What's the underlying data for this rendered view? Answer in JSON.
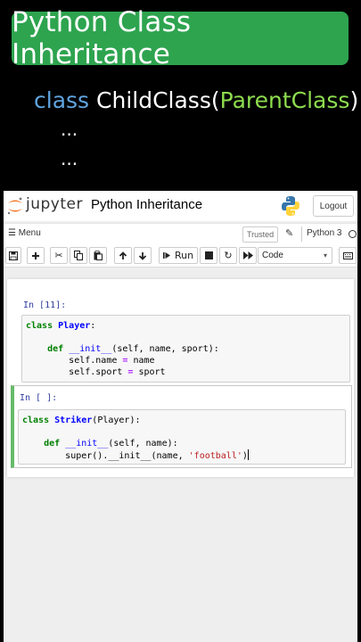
{
  "banner": {
    "title": "Python Class Inheritance"
  },
  "syntax": {
    "class_kw": "class",
    "child": "ChildClass",
    "open_paren": "(",
    "parent": "ParentClass",
    "close": "):",
    "ellipsis_1": "...",
    "ellipsis_2": "..."
  },
  "jupyter": {
    "logo_text": "jupyter",
    "notebook_name": "Python Inheritance",
    "logout_label": "Logout",
    "menu_label": "Menu",
    "trusted_label": "Trusted",
    "kernel_name": "Python 3",
    "run_label": "Run",
    "cell_type": "Code",
    "icons": [
      "save-icon",
      "add-cell-icon",
      "cut-icon",
      "copy-icon",
      "paste-icon",
      "move-up-icon",
      "move-down-icon",
      "run-icon",
      "stop-icon",
      "restart-icon",
      "fast-forward-icon",
      "keyboard-icon"
    ]
  },
  "cells": [
    {
      "prompt": "In [11]:",
      "lines": [
        {
          "kw": "class",
          "name": "Player",
          "rest": ":"
        },
        {
          "text": ""
        },
        {
          "indent": "    ",
          "kw": "def",
          "fn": "__init__",
          "rest": "(self, name, sport):"
        },
        {
          "indent": "        ",
          "a": "self.name ",
          "op": "=",
          "b": " name"
        },
        {
          "indent": "        ",
          "a": "self.sport ",
          "op": "=",
          "b": " sport"
        }
      ]
    },
    {
      "prompt": "In [ ]:",
      "lines": [
        {
          "kw": "class",
          "name": "Striker",
          "rest": "(Player):"
        },
        {
          "text": ""
        },
        {
          "indent": "    ",
          "kw": "def",
          "fn": "__init__",
          "rest": "(self, name):"
        },
        {
          "indent": "        ",
          "a": "super().__init__(name, ",
          "str": "'football'",
          "b": ")"
        }
      ]
    }
  ],
  "colors": {
    "banner": "#2ea44f",
    "keyword_blue": "#5fa4e0",
    "parent_green": "#8ddc4e",
    "selected_cell": "#66bb6a"
  }
}
